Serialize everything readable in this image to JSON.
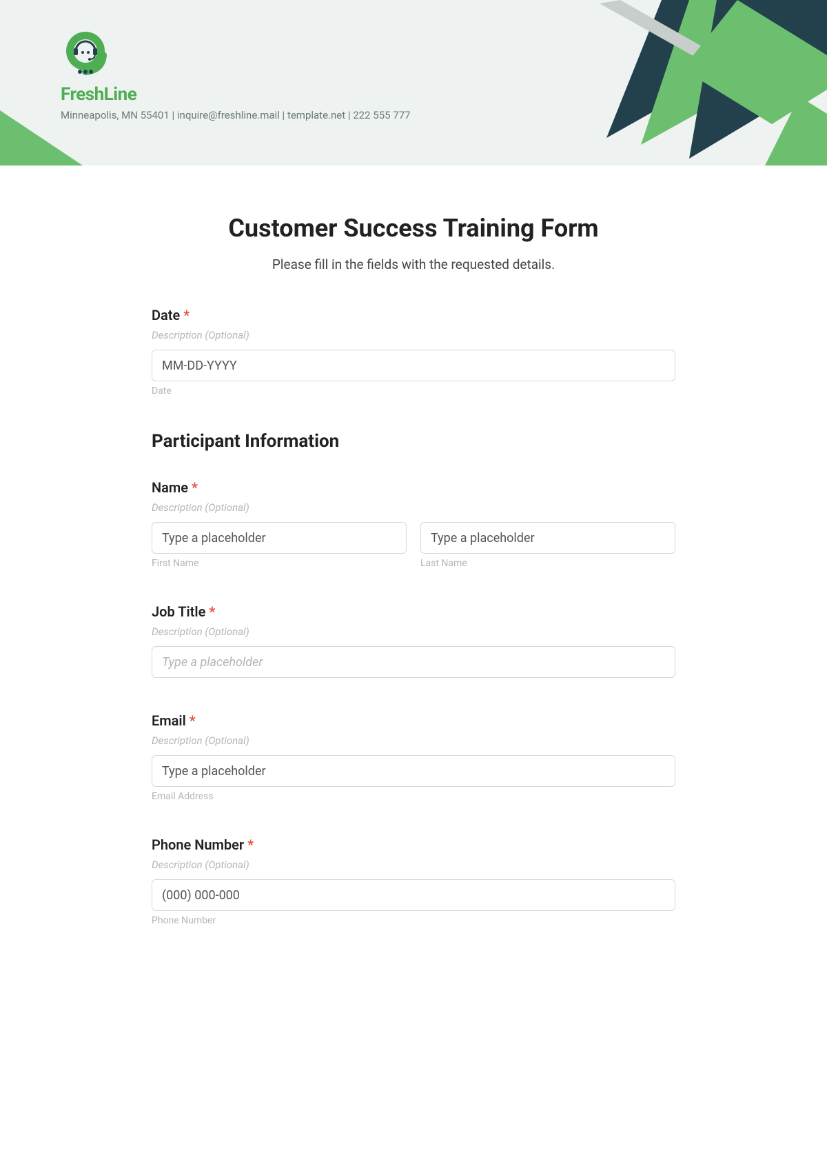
{
  "header": {
    "brand_name": "FreshLine",
    "brand_sub": "Minneapolis, MN 55401 | inquire@freshline.mail | template.net | 222 555 777"
  },
  "form": {
    "title": "Customer Success Training Form",
    "subtitle": "Please fill in the fields with the requested details.",
    "section_participant": "Participant Information",
    "fields": {
      "date": {
        "label": "Date",
        "desc": "Description (Optional)",
        "placeholder": "MM-DD-YYYY",
        "sublabel": "Date"
      },
      "name": {
        "label": "Name",
        "desc": "Description (Optional)",
        "first_placeholder": "Type a placeholder",
        "last_placeholder": "Type a placeholder",
        "first_sub": "First Name",
        "last_sub": "Last Name"
      },
      "job": {
        "label": "Job Title",
        "desc": "Description (Optional)",
        "placeholder": "Type a placeholder"
      },
      "email": {
        "label": "Email",
        "desc": "Description (Optional)",
        "placeholder": "Type a placeholder",
        "sublabel": "Email Address"
      },
      "phone": {
        "label": "Phone Number",
        "desc": "Description (Optional)",
        "placeholder": "(000) 000-000",
        "sublabel": "Phone Number"
      }
    },
    "required_mark": "*"
  }
}
